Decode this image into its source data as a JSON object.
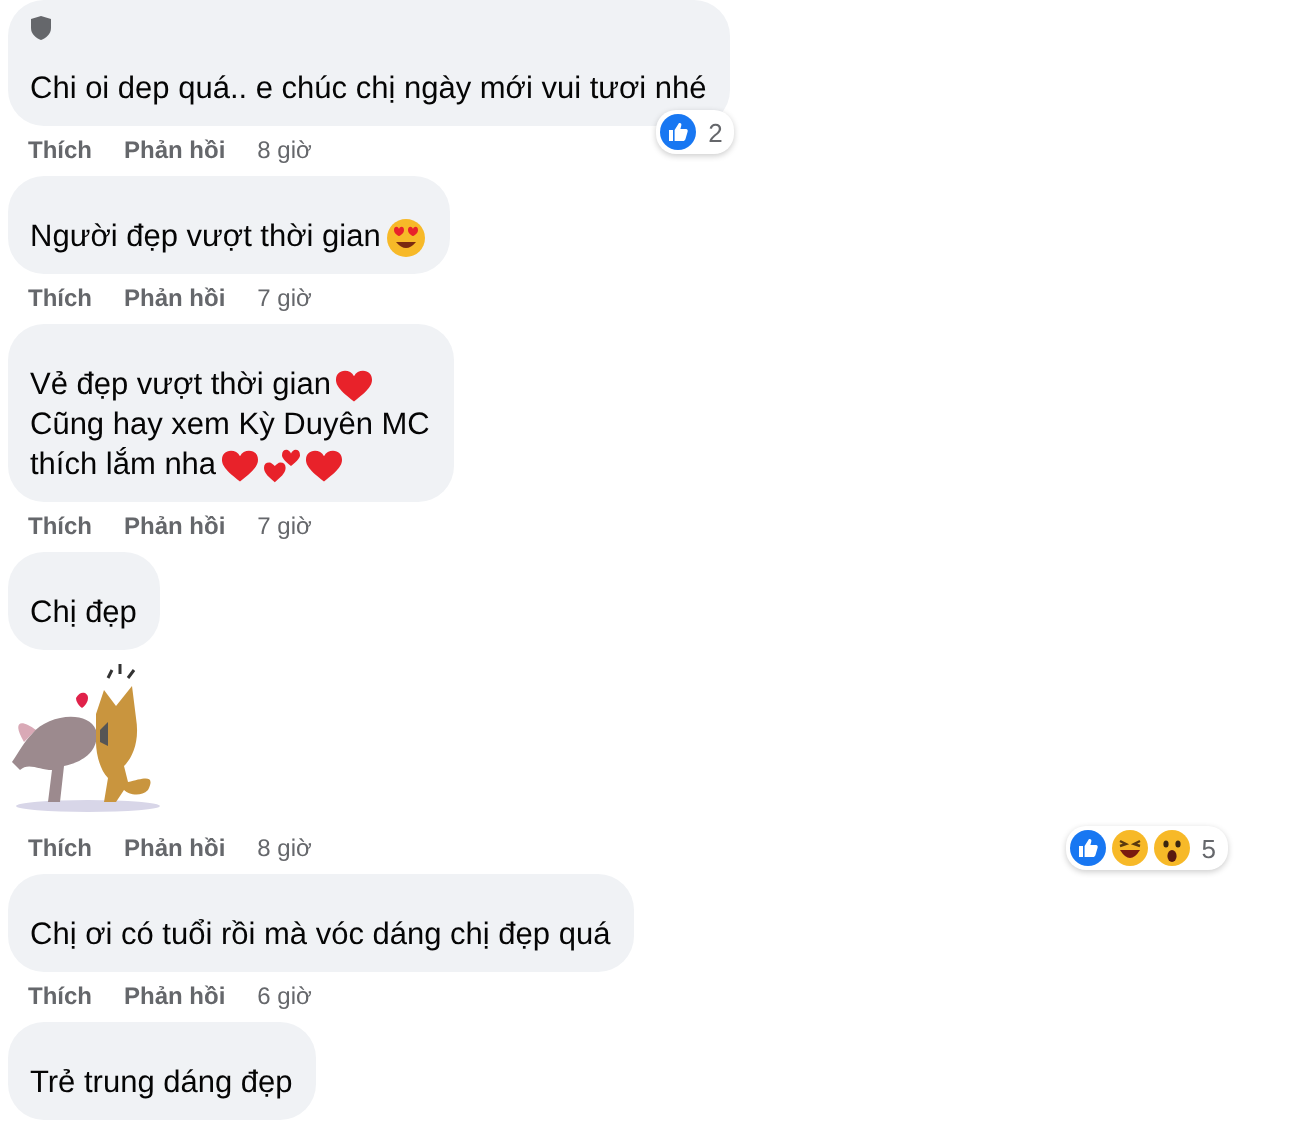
{
  "comments": [
    {
      "badge": true,
      "lines": [
        {
          "text": "Chi oi dep quá.. e chúc chị ngày mới vui tươi nhé"
        }
      ],
      "actions": {
        "like": "Thích",
        "reply": "Phản hồi",
        "time": "8 giờ"
      },
      "reactions": {
        "on_bubble": true,
        "types": [
          {
            "kind": "like"
          }
        ],
        "count": "2"
      }
    },
    {
      "lines": [
        {
          "text": "Người đẹp vượt thời gian",
          "emojis": [
            {
              "kind": "heart-eyes"
            }
          ]
        }
      ],
      "actions": {
        "like": "Thích",
        "reply": "Phản hồi",
        "time": "7 giờ"
      }
    },
    {
      "lines": [
        {
          "text": "Vẻ đẹp vượt thời gian",
          "emojis": [
            {
              "kind": "heart"
            }
          ]
        },
        {
          "text": "Cũng hay xem Kỳ Duyên MC"
        },
        {
          "text": "thích lắm nha",
          "emojis": [
            {
              "kind": "heart"
            },
            {
              "kind": "two-hearts"
            },
            {
              "kind": "heart"
            }
          ]
        }
      ],
      "actions": {
        "like": "Thích",
        "reply": "Phản hồi",
        "time": "7 giờ"
      }
    },
    {
      "lines": [
        {
          "text": "Chị đẹp"
        }
      ],
      "sticker": true,
      "actions": {
        "like": "Thích",
        "reply": "Phản hồi",
        "time": "8 giờ"
      },
      "reactions": {
        "on_bubble": false,
        "types": [
          {
            "kind": "like"
          },
          {
            "kind": "haha"
          },
          {
            "kind": "wow"
          }
        ],
        "count": "5"
      }
    },
    {
      "lines": [
        {
          "text": "Chị ơi có tuổi rồi mà vóc dáng chị đẹp quá"
        }
      ],
      "actions": {
        "like": "Thích",
        "reply": "Phản hồi",
        "time": "6 giờ"
      }
    },
    {
      "lines": [
        {
          "text": "Trẻ trung dáng đẹp"
        }
      ]
    }
  ]
}
